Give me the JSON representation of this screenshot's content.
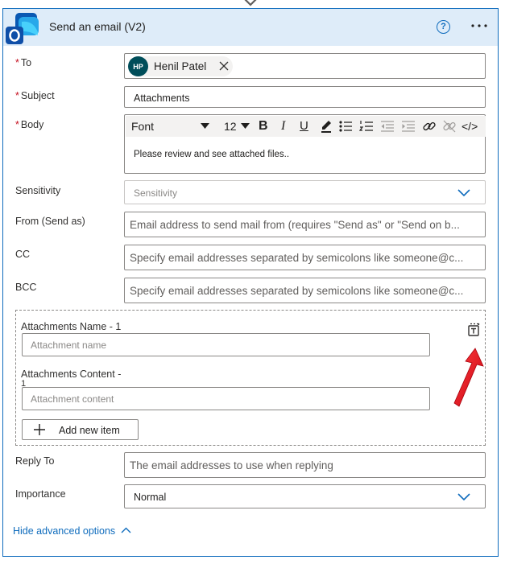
{
  "header": {
    "title": "Send an email (V2)",
    "help_glyph": "?"
  },
  "fields": {
    "to": {
      "label": "To",
      "required_mark": "*",
      "recipient": {
        "initials": "HP",
        "name": "Henil Patel"
      }
    },
    "subject": {
      "label": "Subject",
      "required_mark": "*",
      "value": "Attachments"
    },
    "body": {
      "label": "Body",
      "required_mark": "*",
      "font": "Font",
      "font_size": "12",
      "bold": "B",
      "italic": "I",
      "underline": "U",
      "code": "</>",
      "value": "Please review and see attached files.."
    },
    "sensitivity": {
      "label": "Sensitivity",
      "placeholder": "Sensitivity"
    },
    "from": {
      "label": "From (Send as)",
      "placeholder": "Email address to send mail from (requires \"Send as\" or \"Send on b..."
    },
    "cc": {
      "label": "CC",
      "placeholder": "Specify email addresses separated by semicolons like someone@c..."
    },
    "bcc": {
      "label": "BCC",
      "placeholder": "Specify email addresses separated by semicolons like someone@c..."
    },
    "attachments": {
      "name_label": "Attachments Name - 1",
      "name_placeholder": "Attachment name",
      "content_label_line1": "Attachments Content -",
      "content_label_line2": "1",
      "content_placeholder": "Attachment content",
      "add_button": "Add new item"
    },
    "reply_to": {
      "label": "Reply To",
      "placeholder": "The email addresses to use when replying"
    },
    "importance": {
      "label": "Importance",
      "value": "Normal"
    }
  },
  "footer": {
    "hide_advanced": "Hide advanced options"
  },
  "colors": {
    "accent": "#0f6cbd",
    "header_bg": "#deecf9",
    "required": "#c50f1f",
    "arrow": "#e81123",
    "avatar": "#004e5a"
  },
  "icons": [
    "outlook-icon",
    "help-icon",
    "more-icon",
    "close-icon",
    "chevron-down-icon",
    "switch-input-mode-icon",
    "plus-icon",
    "chevron-up-icon"
  ]
}
